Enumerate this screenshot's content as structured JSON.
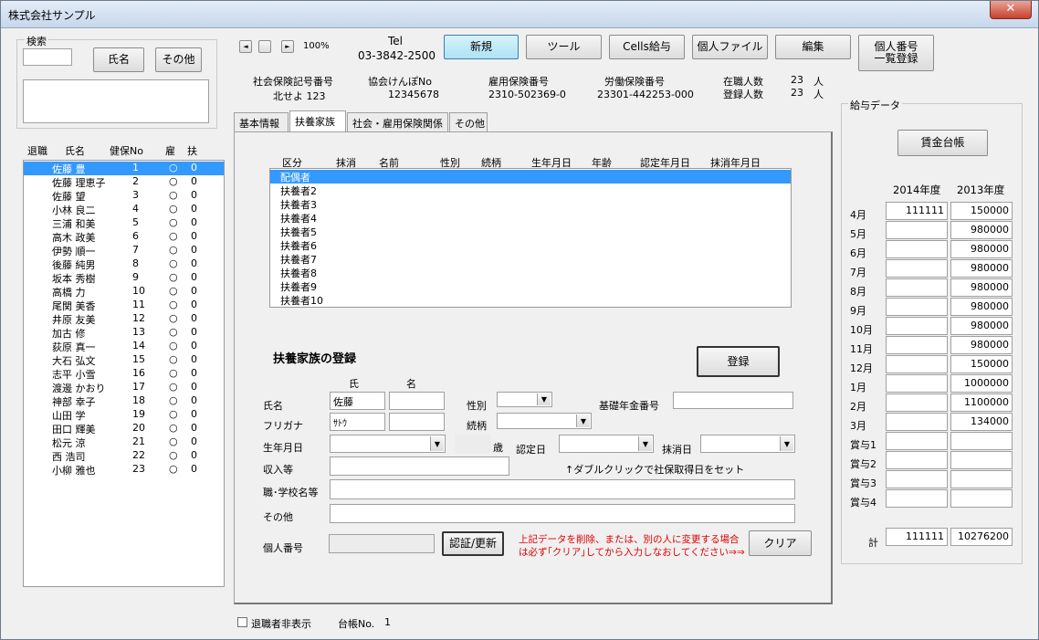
{
  "window": {
    "title": "株式会社サンプル",
    "close_label": "✕"
  },
  "search": {
    "group_title": "検索",
    "input_value": "",
    "name_button": "氏名",
    "other_button": "その他"
  },
  "employee_list": {
    "headers": [
      "退職",
      "氏名",
      "健保No",
      "雇",
      "扶"
    ],
    "rows": [
      {
        "name": "佐藤 豊",
        "no": "1",
        "ko": "○",
        "fu": "0"
      },
      {
        "name": "佐藤 理恵子",
        "no": "2",
        "ko": "○",
        "fu": "0"
      },
      {
        "name": "佐藤 望",
        "no": "3",
        "ko": "○",
        "fu": "0"
      },
      {
        "name": "小林 良二",
        "no": "4",
        "ko": "○",
        "fu": "0"
      },
      {
        "name": "三浦 和美",
        "no": "5",
        "ko": "○",
        "fu": "0"
      },
      {
        "name": "高木 政美",
        "no": "6",
        "ko": "○",
        "fu": "0"
      },
      {
        "name": "伊勢 順一",
        "no": "7",
        "ko": "○",
        "fu": "0"
      },
      {
        "name": "後藤 純男",
        "no": "8",
        "ko": "○",
        "fu": "0"
      },
      {
        "name": "坂本 秀樹",
        "no": "9",
        "ko": "○",
        "fu": "0"
      },
      {
        "name": "高橋 力",
        "no": "10",
        "ko": "○",
        "fu": "0"
      },
      {
        "name": "尾関 美香",
        "no": "11",
        "ko": "○",
        "fu": "0"
      },
      {
        "name": "井原 友美",
        "no": "12",
        "ko": "○",
        "fu": "0"
      },
      {
        "name": "加古 修",
        "no": "13",
        "ko": "○",
        "fu": "0"
      },
      {
        "name": "荻原 真一",
        "no": "14",
        "ko": "○",
        "fu": "0"
      },
      {
        "name": "大石 弘文",
        "no": "15",
        "ko": "○",
        "fu": "0"
      },
      {
        "name": "志平 小雪",
        "no": "16",
        "ko": "○",
        "fu": "0"
      },
      {
        "name": "渡邊 かおり",
        "no": "17",
        "ko": "○",
        "fu": "0"
      },
      {
        "name": "神部 幸子",
        "no": "18",
        "ko": "○",
        "fu": "0"
      },
      {
        "name": "山田 学",
        "no": "19",
        "ko": "○",
        "fu": "0"
      },
      {
        "name": "田口 輝美",
        "no": "20",
        "ko": "○",
        "fu": "0"
      },
      {
        "name": "松元 涼",
        "no": "21",
        "ko": "○",
        "fu": "0"
      },
      {
        "name": "西 浩司",
        "no": "22",
        "ko": "○",
        "fu": "0"
      },
      {
        "name": "小柳 雅也",
        "no": "23",
        "ko": "○",
        "fu": "0"
      }
    ]
  },
  "nav": {
    "first": "◄",
    "prev": "",
    "next": "►",
    "zoom": "100%"
  },
  "tel": {
    "label": "Tel",
    "number": "03-3842-2500"
  },
  "toolbar": {
    "new": "新規",
    "tool": "ツール",
    "cells": "Cells給与",
    "personal_file": "個人ファイル",
    "edit": "編集",
    "mynumber_line1": "個人番号",
    "mynumber_line2": "一覧登録"
  },
  "info": {
    "shaho_label": "社会保険記号番号",
    "shaho_value": "北せよ 123",
    "kyokai_label": "協会けんぽNo",
    "kyokai_value": "12345678",
    "koyo_label": "雇用保険番号",
    "koyo_value": "2310-502369-0",
    "rodo_label": "労働保険番号",
    "rodo_value": "23301-442253-000",
    "zaishoku_label": "在職人数",
    "zaishoku_value": "23",
    "zaishoku_unit": "人",
    "toroku_label": "登録人数",
    "toroku_value": "23",
    "toroku_unit": "人"
  },
  "tabs": [
    "基本情報",
    "扶養家族",
    "社会・雇用保険関係",
    "その他"
  ],
  "dependents": {
    "headers": [
      "区分",
      "抹消",
      "名前",
      "性別",
      "続柄",
      "生年月日",
      "年齢",
      "認定年月日",
      "抹消年月日"
    ],
    "rows": [
      "配偶者",
      "扶養者2",
      "扶養者3",
      "扶養者4",
      "扶養者5",
      "扶養者6",
      "扶養者7",
      "扶養者8",
      "扶養者9",
      "扶養者10"
    ]
  },
  "form": {
    "title": "扶養家族の登録",
    "register": "登録",
    "col_sei": "氏",
    "col_mei": "名",
    "name_label": "氏名",
    "name_sei": "佐藤",
    "name_mei": "",
    "kana_label": "フリガナ",
    "kana_sei": "ｻﾄｳ",
    "kana_mei": "",
    "gender_label": "性別",
    "relation_label": "続柄",
    "pension_label": "基礎年金番号",
    "birth_label": "生年月日",
    "age_unit": "歳",
    "nintei_label": "認定日",
    "masshou_label": "抹消日",
    "income_label": "収入等",
    "income_hint": "↑ダブルクリックで社保取得日をセット",
    "school_label": "職･学校名等",
    "other_label": "その他",
    "mynumber_label": "個人番号",
    "auth_button": "認証/更新",
    "warning_line1": "上記データを削除、または、別の人に変更する場合",
    "warning_line2": "は必ず｢クリア｣してから入力しなおしてください⇒⇒",
    "clear_button": "クリア"
  },
  "salary": {
    "group_title": "給与データ",
    "ledger_button": "賃金台帳",
    "col1": "2014年度",
    "col2": "2013年度",
    "rows": [
      {
        "m": "4月",
        "a": "111111",
        "b": "150000"
      },
      {
        "m": "5月",
        "a": "",
        "b": "980000"
      },
      {
        "m": "6月",
        "a": "",
        "b": "980000"
      },
      {
        "m": "7月",
        "a": "",
        "b": "980000"
      },
      {
        "m": "8月",
        "a": "",
        "b": "980000"
      },
      {
        "m": "9月",
        "a": "",
        "b": "980000"
      },
      {
        "m": "10月",
        "a": "",
        "b": "980000"
      },
      {
        "m": "11月",
        "a": "",
        "b": "980000"
      },
      {
        "m": "12月",
        "a": "",
        "b": "150000"
      },
      {
        "m": "1月",
        "a": "",
        "b": "1000000"
      },
      {
        "m": "2月",
        "a": "",
        "b": "1100000"
      },
      {
        "m": "3月",
        "a": "",
        "b": "134000"
      },
      {
        "m": "賞与1",
        "a": "",
        "b": ""
      },
      {
        "m": "賞与2",
        "a": "",
        "b": ""
      },
      {
        "m": "賞与3",
        "a": "",
        "b": ""
      },
      {
        "m": "賞与4",
        "a": "",
        "b": ""
      }
    ],
    "total_label": "計",
    "total_a": "111111",
    "total_b": "10276200"
  },
  "footer": {
    "hide_retired": "退職者非表示",
    "ledger_no_label": "台帳No.",
    "ledger_no": "1"
  }
}
